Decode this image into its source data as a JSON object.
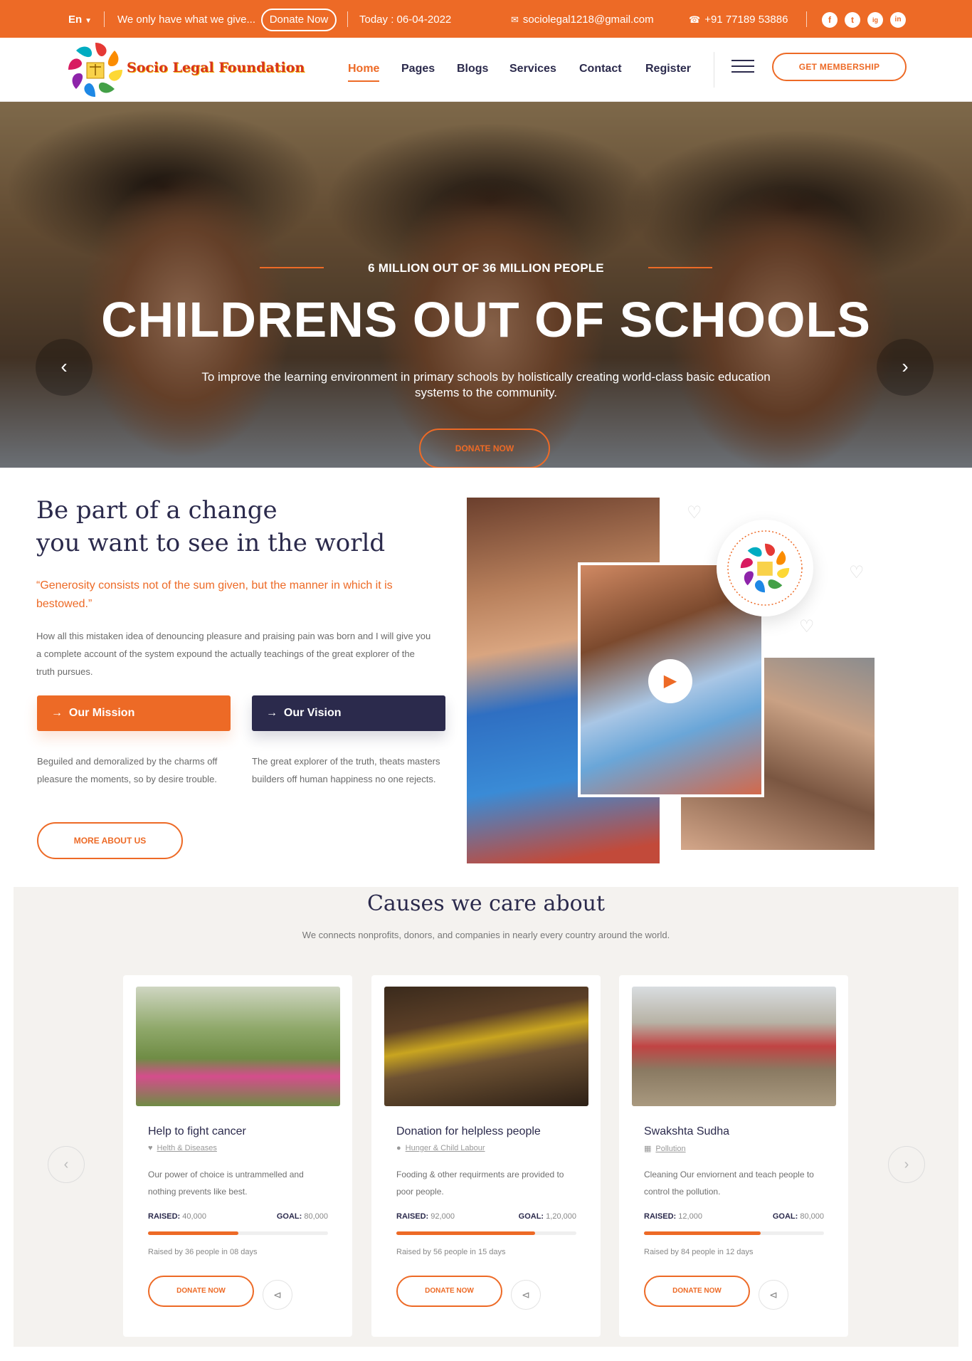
{
  "topbar": {
    "language": "En",
    "ticker_text": "We only have what we give...",
    "donate_pill": "Donate Now",
    "today": "Today : 06-04-2022",
    "email": "sociolegal1218@gmail.com",
    "phone": "+91 77189 53886",
    "social": [
      "f",
      "t",
      "ig",
      "in"
    ]
  },
  "brand": {
    "name": "Socio Legal Foundation"
  },
  "nav": {
    "items": [
      "Home",
      "Pages",
      "Blogs",
      "Services",
      "Contact",
      "Register"
    ],
    "membership": "GET MEMBERSHIP"
  },
  "hero": {
    "pre_title": "6 MILLION OUT OF 36 MILLION PEOPLE",
    "title": "CHILDRENS OUT OF SCHOOLS",
    "subtitle": "To improve the learning environment in primary schools by holistically creating world-class basic education systems to the community.",
    "cta": "DONATE NOW"
  },
  "about": {
    "title_line1": "Be part of a change",
    "title_line2": "you want to see in the world",
    "quote": "“Generosity consists not of the sum given, but the manner in which it is bestowed.”",
    "paragraph": "How all this mistaken idea of denouncing pleasure and praising pain was born and I will give you a complete account of the system expound the actually teachings of the great explorer of the truth pursues.",
    "mission_label": "Our Mission",
    "vision_label": "Our Vision",
    "mission_text": "Beguiled and demoralized by the charms off pleasure the moments, so by desire trouble.",
    "vision_text": "The great explorer of the truth, theats masters builders off human happiness no one rejects.",
    "more_btn": "MORE ABOUT US"
  },
  "causes": {
    "title": "Causes we care about",
    "subtitle": "We connects nonprofits, donors, and companies in nearly every country around the world.",
    "cards": [
      {
        "title": "Help to fight cancer",
        "category": "Helth & Diseases",
        "description": "Our power of choice is untrammelled and nothing prevents like best.",
        "raised_label": "RAISED:",
        "raised": "40,000",
        "goal_label": "GOAL:",
        "goal": "80,000",
        "progress": 0.5,
        "byline": "Raised by 36 people in 08 days",
        "cta": "DONATE NOW"
      },
      {
        "title": "Donation for helpless people",
        "category": "Hunger & Child Labour",
        "description": "Fooding & other requirments are provided to poor people.",
        "raised_label": "RAISED:",
        "raised": "92,000",
        "goal_label": "GOAL:",
        "goal": "1,20,000",
        "progress": 0.77,
        "byline": "Raised by 56 people in 15 days",
        "cta": "DONATE NOW"
      },
      {
        "title": "Swakshta Sudha",
        "category": "Pollution",
        "description": "Cleaning Our enviornent and teach people to control the pollution.",
        "raised_label": "RAISED:",
        "raised": "12,000",
        "goal_label": "GOAL:",
        "goal": "80,000",
        "progress": 0.65,
        "byline": "Raised by 84 people in 12 days",
        "cta": "DONATE NOW"
      }
    ]
  },
  "colors": {
    "accent": "#ed6a26",
    "dark": "#2b2a4c"
  }
}
